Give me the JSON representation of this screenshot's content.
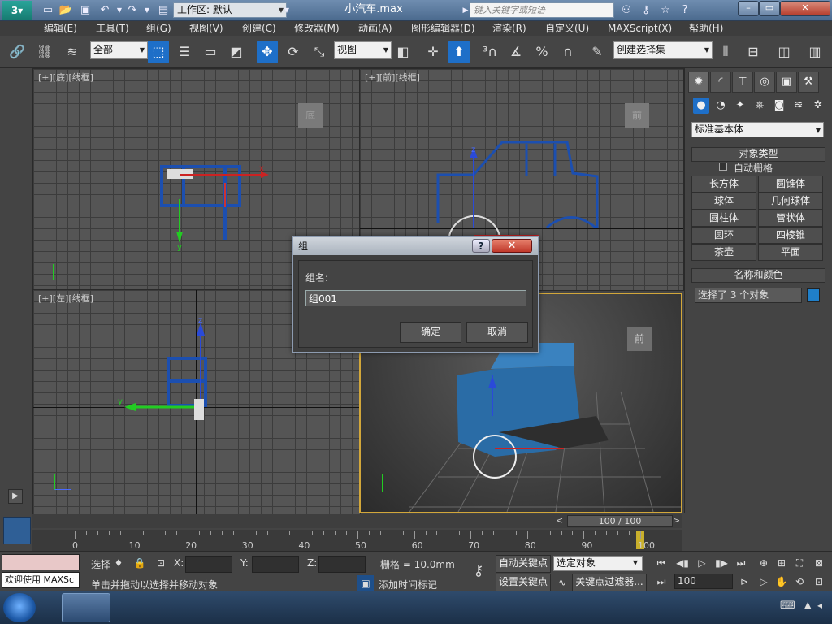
{
  "titlebar": {
    "workspace": "工作区: 默认",
    "doc_title": "小汽车.max",
    "search_placeholder": "键入关键字或短语",
    "quick_icons": [
      "new-icon",
      "open-icon",
      "save-icon",
      "undo-icon",
      "redo-icon",
      "project-folder-icon"
    ],
    "search_tools": [
      "binoculars-icon",
      "key-icon",
      "star-icon",
      "help-icon"
    ]
  },
  "menu": [
    "编辑(E)",
    "工具(T)",
    "组(G)",
    "视图(V)",
    "创建(C)",
    "修改器(M)",
    "动画(A)",
    "图形编辑器(D)",
    "渲染(R)",
    "自定义(U)",
    "MAXScript(X)",
    "帮助(H)"
  ],
  "toolbar": {
    "selection_filter": "全部",
    "ref_coord": "视图",
    "named_selection": "创建选择集"
  },
  "viewports": {
    "top_left": {
      "label": "[+][底][线框]",
      "cube": "底"
    },
    "top_right": {
      "label": "[+][前][线框]",
      "cube": "前"
    },
    "bottom_left": {
      "label": "[+][左][线框]"
    },
    "bottom_right": {
      "cube": "前"
    },
    "axis_z": "z",
    "axis_y": "y",
    "axis_x": "x"
  },
  "cmdpanel": {
    "category": "标准基本体",
    "rollout_object_type": "对象类型",
    "auto_grid": "自动栅格",
    "object_buttons": [
      "长方体",
      "圆锥体",
      "球体",
      "几何球体",
      "圆柱体",
      "管状体",
      "圆环",
      "四棱锥",
      "茶壶",
      "平面"
    ],
    "rollout_name_color": "名称和颜色",
    "name_field": "选择了 3 个对象",
    "object_color": "#1f7fc9"
  },
  "dialog": {
    "title": "组",
    "help": "?",
    "label": "组名:",
    "value": "组001",
    "ok": "确定",
    "cancel": "取消"
  },
  "timeline": {
    "frame": "100 / 100",
    "ticks": [
      "0",
      "10",
      "20",
      "30",
      "40",
      "50",
      "60",
      "70",
      "80",
      "90",
      "100"
    ]
  },
  "status": {
    "welcome": "欢迎使用 MAXSc",
    "select_label": "选择",
    "x_label": "X:",
    "y_label": "Y:",
    "z_label": "Z:",
    "grid": "栅格 = 10.0mm",
    "prompt": "单击并拖动以选择并移动对象",
    "add_time_tag": "添加时间标记",
    "auto_key": "自动关键点",
    "set_key": "设置关键点",
    "key_mode": "选定对象",
    "key_filters": "关键点过滤器...",
    "current_frame": "100"
  }
}
